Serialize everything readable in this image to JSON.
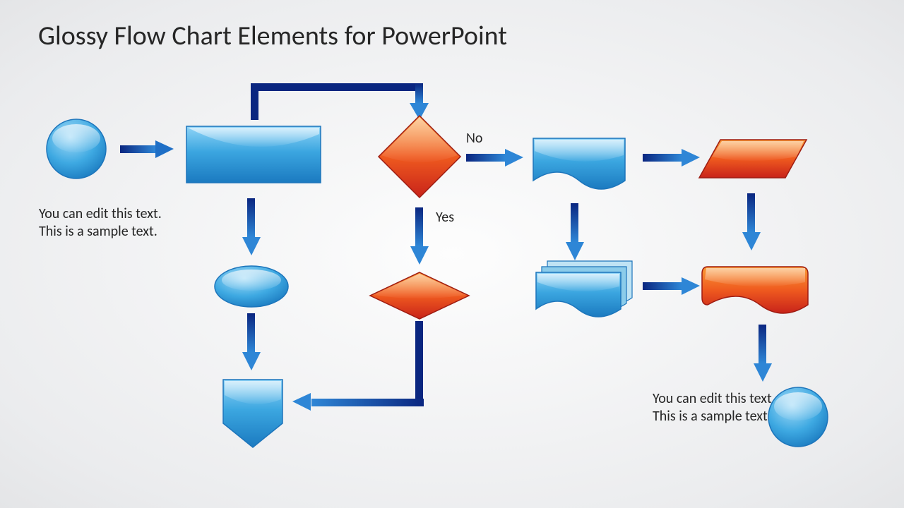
{
  "title": "Glossy Flow Chart Elements for PowerPoint",
  "captions": {
    "left": "You can edit this text. This is a sample text.",
    "right": "You can edit this text. This is a sample text."
  },
  "labels": {
    "no": "No",
    "yes": "Yes"
  },
  "colors": {
    "blueLight": "#6bc3f0",
    "blueMid": "#2f9fdc",
    "blueDark": "#0e6db0",
    "blueStroke": "#1d75bb",
    "arrow": "#0b2d8e",
    "arrowLight": "#2b7fd1",
    "orangeLight": "#f88a2a",
    "orangeDark": "#d72f1a",
    "orangeStroke": "#9e1c12"
  },
  "flowchart": {
    "nodes": [
      {
        "id": "start-circle",
        "type": "circle",
        "color": "blue"
      },
      {
        "id": "process-rect",
        "type": "process",
        "color": "blue"
      },
      {
        "id": "decision-diamond",
        "type": "decision",
        "color": "orange"
      },
      {
        "id": "doc-blue",
        "type": "document",
        "color": "blue"
      },
      {
        "id": "data-parallelogram",
        "type": "data",
        "color": "orange"
      },
      {
        "id": "ellipse-blue",
        "type": "terminator",
        "color": "blue"
      },
      {
        "id": "flat-decision",
        "type": "decision-flat",
        "color": "orange"
      },
      {
        "id": "multi-doc",
        "type": "multi-document",
        "color": "blue"
      },
      {
        "id": "display-orange",
        "type": "display",
        "color": "orange"
      },
      {
        "id": "offpage",
        "type": "offpage",
        "color": "blue"
      },
      {
        "id": "end-circle",
        "type": "circle",
        "color": "blue"
      }
    ],
    "edges": [
      {
        "from": "start-circle",
        "to": "process-rect"
      },
      {
        "from": "process-rect",
        "to": "decision-diamond",
        "path": "up-right-down"
      },
      {
        "from": "process-rect",
        "to": "ellipse-blue",
        "dir": "down"
      },
      {
        "from": "decision-diamond",
        "to": "doc-blue",
        "label": "No"
      },
      {
        "from": "decision-diamond",
        "to": "flat-decision",
        "label": "Yes",
        "dir": "down"
      },
      {
        "from": "doc-blue",
        "to": "data-parallelogram"
      },
      {
        "from": "doc-blue",
        "to": "multi-doc",
        "dir": "down"
      },
      {
        "from": "data-parallelogram",
        "to": "display-orange",
        "dir": "down"
      },
      {
        "from": "multi-doc",
        "to": "display-orange"
      },
      {
        "from": "display-orange",
        "to": "end-circle",
        "dir": "down"
      },
      {
        "from": "ellipse-blue",
        "to": "offpage",
        "dir": "down"
      },
      {
        "from": "flat-decision",
        "to": "offpage",
        "path": "down-left"
      }
    ]
  }
}
